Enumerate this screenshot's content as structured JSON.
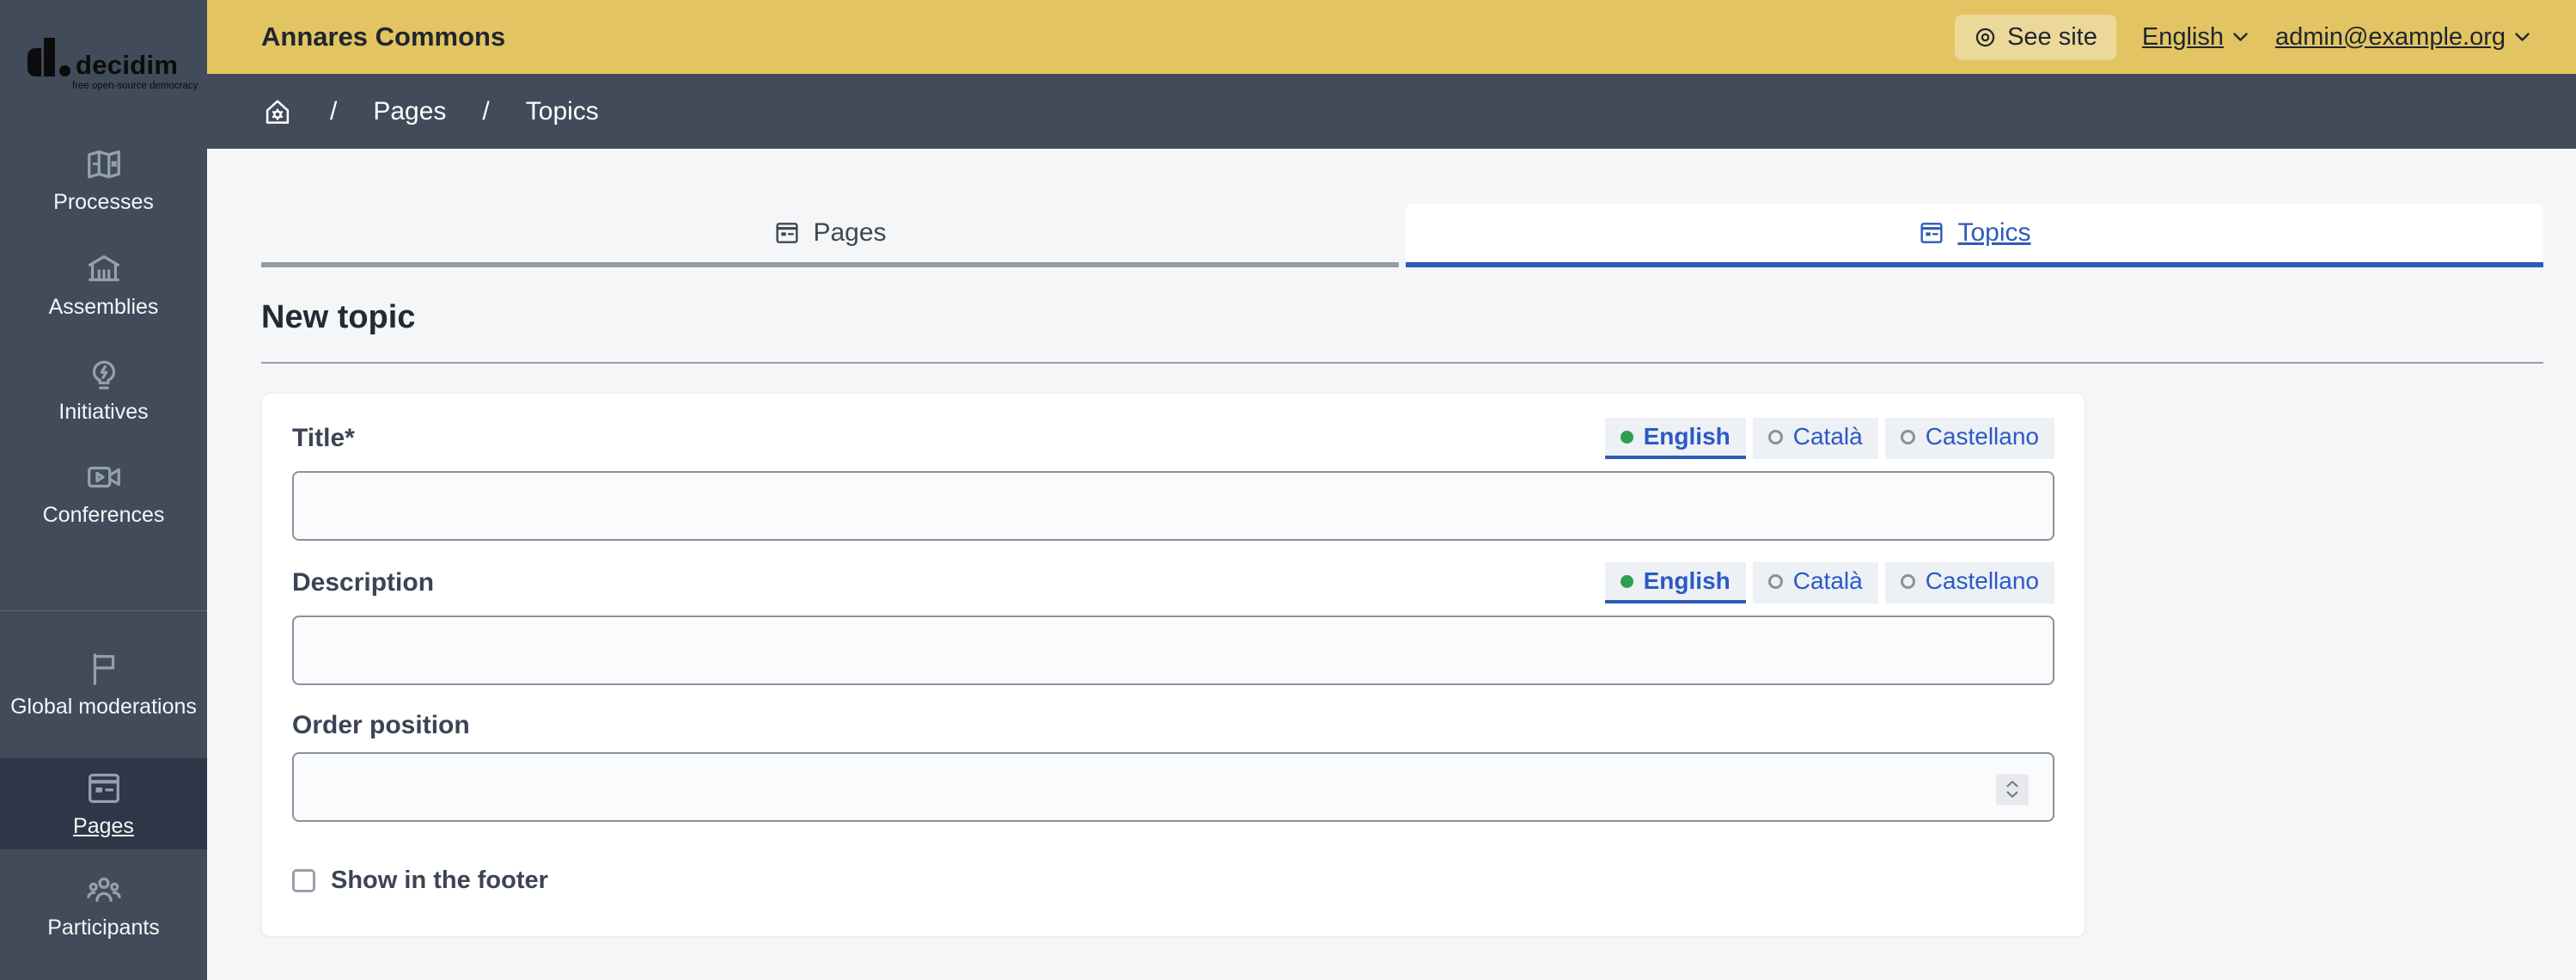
{
  "topbar": {
    "site_title": "Annares Commons",
    "see_site": "See site",
    "language": "English",
    "user_email": "admin@example.org"
  },
  "breadcrumb": {
    "separator": "/",
    "items": [
      "Pages",
      "Topics"
    ]
  },
  "sidebar": {
    "logo": {
      "name": "decidim",
      "tagline": "free open-source democracy"
    },
    "items": [
      {
        "label": "Processes",
        "icon": "map-icon",
        "active": false
      },
      {
        "label": "Assemblies",
        "icon": "bank-icon",
        "active": false
      },
      {
        "label": "Initiatives",
        "icon": "lightbulb-icon",
        "active": false
      },
      {
        "label": "Conferences",
        "icon": "video-camera-icon",
        "active": false
      },
      {
        "label": "Global moderations",
        "icon": "flag-icon",
        "active": false
      },
      {
        "label": "Pages",
        "icon": "article-icon",
        "active": true
      },
      {
        "label": "Participants",
        "icon": "people-icon",
        "active": false
      }
    ]
  },
  "tabs": [
    {
      "label": "Pages",
      "icon": "article-icon",
      "active": false
    },
    {
      "label": "Topics",
      "icon": "article-icon",
      "active": true
    }
  ],
  "content": {
    "heading": "New topic",
    "form": {
      "title_label": "Title*",
      "title_value": "",
      "description_label": "Description",
      "description_value": "",
      "order_label": "Order position",
      "order_value": "",
      "footer_checkbox_label": "Show in the footer",
      "footer_checkbox_checked": false,
      "languages": [
        {
          "label": "English",
          "selected": true
        },
        {
          "label": "Català",
          "selected": false
        },
        {
          "label": "Castellano",
          "selected": false
        }
      ]
    }
  },
  "colors": {
    "header_yellow": "#e2c462",
    "sidebar_slate": "#414b59",
    "sidebar_active": "#2e3747",
    "accent_blue": "#2d5cb8",
    "link_blue": "#2b5ac6",
    "selected_green": "#2f9e4f",
    "page_background": "#f5f6f8",
    "inactive_tab_border": "#959ba4"
  }
}
